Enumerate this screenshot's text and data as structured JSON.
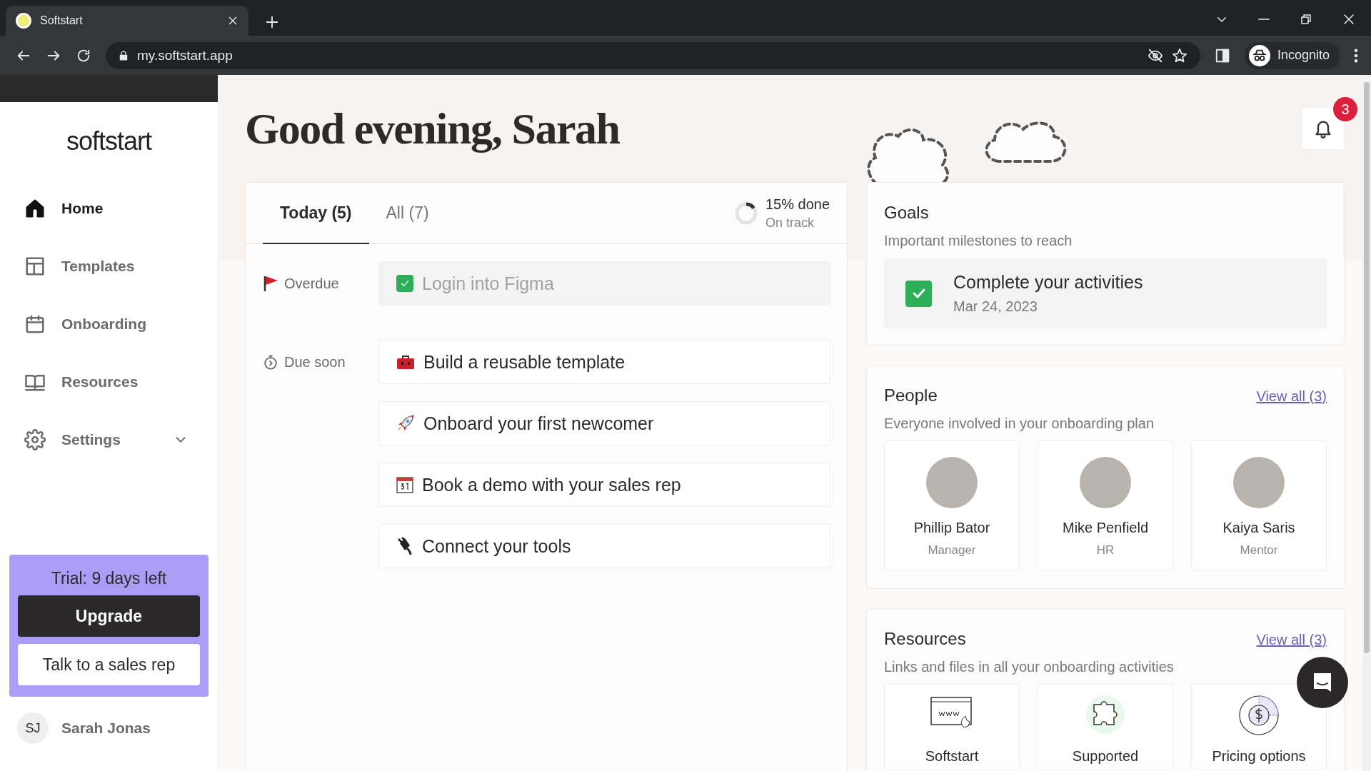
{
  "browser": {
    "tab_title": "Softstart",
    "url": "my.softstart.app",
    "profile": "Incognito"
  },
  "sidebar": {
    "logo": "softstart",
    "items": [
      {
        "label": "Home",
        "selected": true
      },
      {
        "label": "Templates",
        "selected": false
      },
      {
        "label": "Onboarding",
        "selected": false
      },
      {
        "label": "Resources",
        "selected": false
      },
      {
        "label": "Settings",
        "selected": false,
        "expandable": true
      }
    ],
    "trial": {
      "text": "Trial: 9 days left",
      "primary_button": "Upgrade",
      "secondary_button": "Talk to a sales rep"
    },
    "user": {
      "initials": "SJ",
      "name": "Sarah Jonas"
    }
  },
  "greeting": "Good evening, Sarah",
  "notifications": {
    "count": "3"
  },
  "tasks": {
    "tabs": [
      {
        "label": "Today (5)",
        "selected": true
      },
      {
        "label": "All (7)",
        "selected": false
      }
    ],
    "progress": {
      "level": 0.15,
      "label": "15% done",
      "status": "On track"
    },
    "groups": [
      {
        "kind": "overdue",
        "label": "Overdue",
        "items": [
          {
            "title": "Login into Figma",
            "checked": true
          }
        ]
      },
      {
        "kind": "due_soon",
        "label": "Due soon",
        "items": [
          {
            "title": "Build a reusable template",
            "checked": false
          },
          {
            "title": "Onboard your first newcomer",
            "checked": false
          },
          {
            "title": "Book a demo with your sales rep",
            "checked": false
          },
          {
            "title": "Connect your tools",
            "checked": false
          }
        ]
      }
    ]
  },
  "goals": {
    "title": "Goals",
    "subtitle": "Important milestones to reach",
    "items": [
      {
        "title": "Complete your activities",
        "date": "Mar 24, 2023",
        "checked": true
      }
    ]
  },
  "people": {
    "title": "People",
    "link": "View all (3)",
    "subtitle": "Everyone involved in your onboarding plan",
    "items": [
      {
        "name": "Phillip Bator",
        "role": "Manager"
      },
      {
        "name": "Mike Penfield",
        "role": "HR"
      },
      {
        "name": "Kaiya Saris",
        "role": "Mentor"
      }
    ]
  },
  "resources": {
    "title": "Resources",
    "link": "View all (3)",
    "subtitle": "Links and files in all your onboarding activities",
    "items": [
      {
        "label": "Softstart"
      },
      {
        "label": "Supported"
      },
      {
        "label": "Pricing options"
      }
    ]
  }
}
